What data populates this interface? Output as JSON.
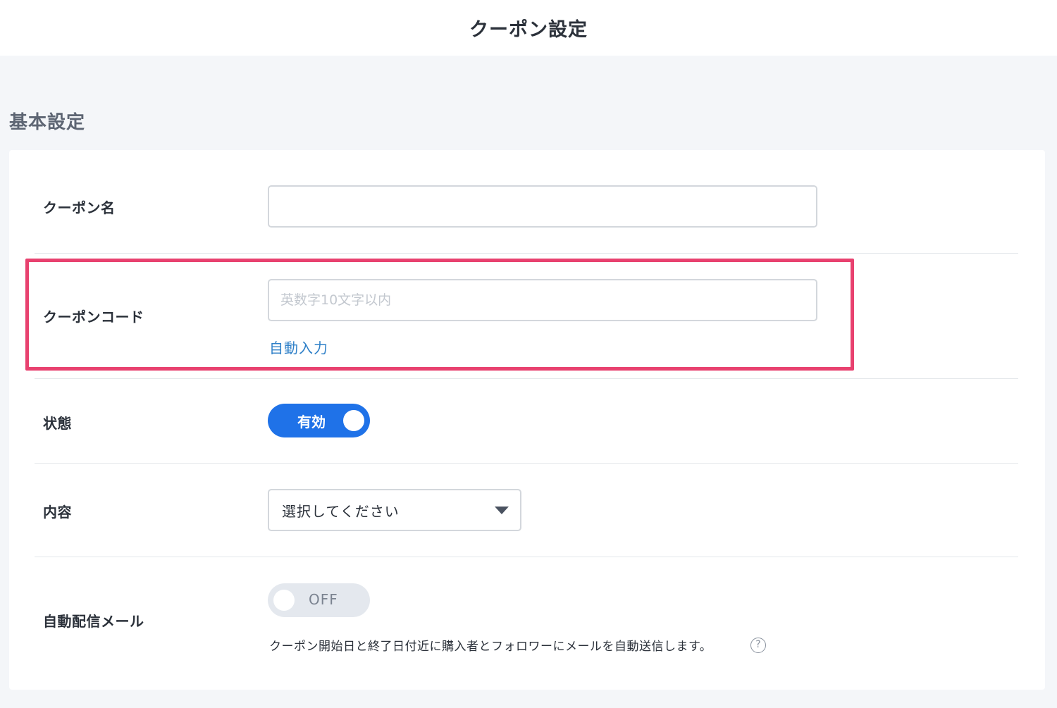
{
  "header": {
    "title": "クーポン設定"
  },
  "section": {
    "title": "基本設定"
  },
  "form": {
    "coupon_name": {
      "label": "クーポン名",
      "value": "",
      "placeholder": ""
    },
    "coupon_code": {
      "label": "クーポンコード",
      "value": "",
      "placeholder": "英数字10文字以内",
      "auto_fill_label": "自動入力"
    },
    "status": {
      "label": "状態",
      "toggle_label": "有効",
      "enabled": true
    },
    "content": {
      "label": "内容",
      "selected": "選択してください"
    },
    "auto_mail": {
      "label": "自動配信メール",
      "toggle_label": "OFF",
      "enabled": false,
      "help_text": "クーポン開始日と終了日付近に購入者とフォロワーにメールを自動送信します。",
      "help_icon": "?"
    }
  },
  "colors": {
    "accent": "#1f72e8",
    "link": "#2f80c8",
    "highlight": "#e8416f"
  }
}
